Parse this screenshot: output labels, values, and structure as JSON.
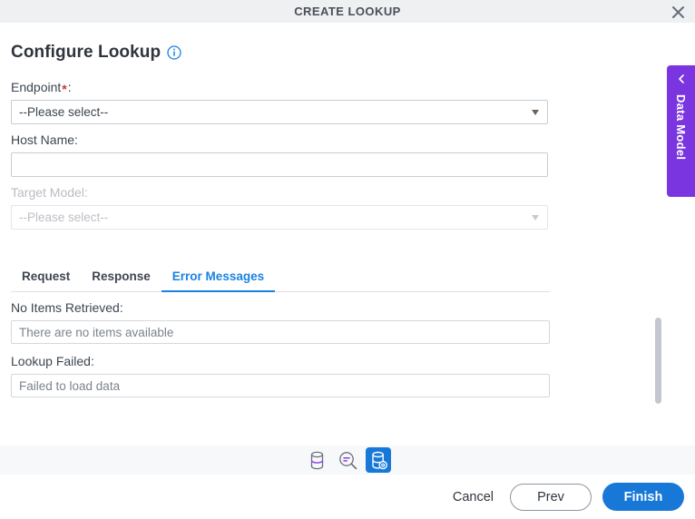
{
  "window": {
    "title": "CREATE LOOKUP",
    "close_icon": "close-icon"
  },
  "page": {
    "heading": "Configure Lookup",
    "info_icon": "info-circle-icon"
  },
  "form": {
    "endpoint": {
      "label": "Endpoint",
      "required_mark": "*",
      "colon": ":",
      "value": "--Please select--"
    },
    "host_name": {
      "label": "Host Name:",
      "value": ""
    },
    "target_model": {
      "label": "Target Model:",
      "value": "--Please select--",
      "disabled": true
    }
  },
  "tabs": {
    "items": [
      {
        "label": "Request",
        "active": false
      },
      {
        "label": "Response",
        "active": false
      },
      {
        "label": "Error Messages",
        "active": true
      }
    ]
  },
  "error_messages_panel": {
    "no_items_retrieved": {
      "label": "No Items Retrieved:",
      "value": "There are no items available"
    },
    "lookup_failed": {
      "label": "Lookup Failed:",
      "value": "Failed to load data"
    }
  },
  "side_panel": {
    "label": "Data Model",
    "chevron_icon": "chevron-left-icon",
    "color": "#7a35e0"
  },
  "toolbar": {
    "buttons": [
      {
        "name": "database-icon",
        "active": false
      },
      {
        "name": "search-data-icon",
        "active": false
      },
      {
        "name": "database-settings-icon",
        "active": true
      }
    ]
  },
  "footer": {
    "cancel_label": "Cancel",
    "prev_label": "Prev",
    "finish_label": "Finish",
    "primary_color": "#1778d8"
  }
}
